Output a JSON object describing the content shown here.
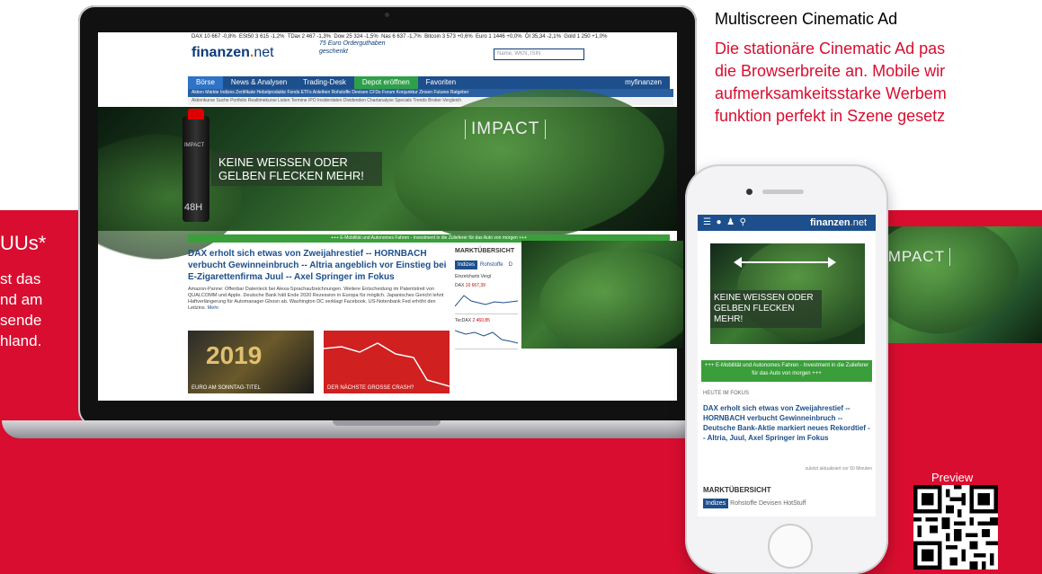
{
  "left_panel": {
    "title": "UUs*",
    "lines": [
      "st das",
      "nd am",
      "sende",
      "hland."
    ]
  },
  "right_panel": {
    "title": "Multiscreen Cinematic Ad",
    "lines": [
      "Die stationäre Cinematic Ad pas",
      "die Browserbreite an. Mobile wir",
      "aufmerksamkeitsstarke Werbem",
      "funktion perfekt in Szene gesetz"
    ]
  },
  "desktop": {
    "ticker": [
      "DAX 10 667 -0,8%",
      "ESt50 3 615 -1,2%",
      "TDax 2 467 -1,3%",
      "Dow 25 324 -1,5%",
      "Nas 6 637 -1,7%",
      "Bitcoin 3 573 +0,6%",
      "Euro 1 1446 +0,0%",
      "Öl 35,34 -2,1%",
      "Gold 1 250 +1,0%"
    ],
    "logo_main": "finanzen",
    "logo_dot": ".",
    "logo_suffix": "net",
    "promo": "75 Euro Orderguthaben geschenkt",
    "search_placeholder": "Name, WKN, ISIN",
    "nav": [
      "Börse",
      "News & Analysen",
      "Trading-Desk",
      "Depot eröffnen",
      "Favoriten"
    ],
    "nav_right": "myfinanzen",
    "subnav": "Aktien  Märkte  Indizes  Zertifikate  Hebelprodukte  Fonds  ETFs  Anleihen  Rohstoffe  Devisen  CFDs  Forum  Konjunktur  Zinsen  Futures  Ratgeber",
    "subnav2": "Aktienkurse  Suche  Portfolio  Realtimekurse  Listen  Termine  IPO  Insiderdaten  Dividenden  Chartanalyse  Specials  Trends  Broker-Vergleich",
    "banner": {
      "impact": "IMPACT",
      "slogan": "KEINE WEISSEN ODER GELBEN FLECKEN MEHR!",
      "product_brand": "IMPACT",
      "product_label": "48H"
    },
    "green_bar": "+++ E-Mobilität und Autonomes Fahren - Investment in die Zulieferer für das Auto von morgen +++",
    "article": {
      "title": "DAX erholt sich etwas von Zweijahrestief -- HORNBACH verbucht Gewinneinbruch -- Altria angeblich vor Einstieg bei E-Zigarettenfirma Juul -- Axel Springer im Fokus",
      "text": "Amazon-Panne: Offenbar Datenleck bei Alexa-Sprachaufzeichnungen. Weitere Entscheidung im Patentstreit von QUALCOMM und Apple. Deutsche Bank hält Ende 2020 Rezession in Europa für möglich. Japanisches Gericht lehnt Haftverlängerung für Automanager Ghosn ab. Washington DC verklagt Facebook. US-Notenbank Fed erhöht den Leitzins.",
      "more": "Mehr"
    },
    "thumbs": [
      {
        "big": "2019",
        "caption": "EURO AM SONNTAG-TITEL"
      },
      {
        "caption": "DER NÄCHSTE GROSSE CRASH?"
      }
    ],
    "market": {
      "title": "MARKTÜBERSICHT",
      "tabs": [
        "Indizes",
        "Rohstoffe",
        "D"
      ],
      "subtabs": [
        "Einzelcharts",
        "Vergl"
      ],
      "rows": [
        {
          "name": "DAX",
          "value": "10 667,39"
        },
        {
          "name": "TecDAX",
          "value": "2 460,85"
        }
      ]
    }
  },
  "mobile": {
    "logo_main": "finanzen",
    "logo_dot": ".",
    "logo_suffix": "net",
    "banner": {
      "slogan": "KEINE WEISSEN ODER GELBEN FLECKEN MEHR!"
    },
    "green_bar": "+++ E-Mobilität und Autonomes Fahren - Investment in die Zulieferer für das Auto von morgen +++",
    "label": "HEUTE IM FOKUS",
    "article_title": "DAX erholt sich etwas von Zweijahrestief -- HORNBACH verbucht Gewinneinbruch -- Deutsche Bank-Aktie markiert neues Rekordtief -- Altria, Juul, Axel Springer im Fokus",
    "updated": "zuletzt aktualisiert vor 50 Minuten",
    "market_title": "MARKTÜBERSICHT",
    "market_tabs": [
      "Indizes",
      "Rohstoffe",
      "Devisen",
      "HotStuff"
    ]
  },
  "strip": {
    "impact": "IMPACT"
  },
  "preview": {
    "label": "Preview"
  },
  "colors": {
    "brand_red": "#d90d2f",
    "nav_blue": "#1d4f8c",
    "accent_green": "#3a9e3a"
  }
}
